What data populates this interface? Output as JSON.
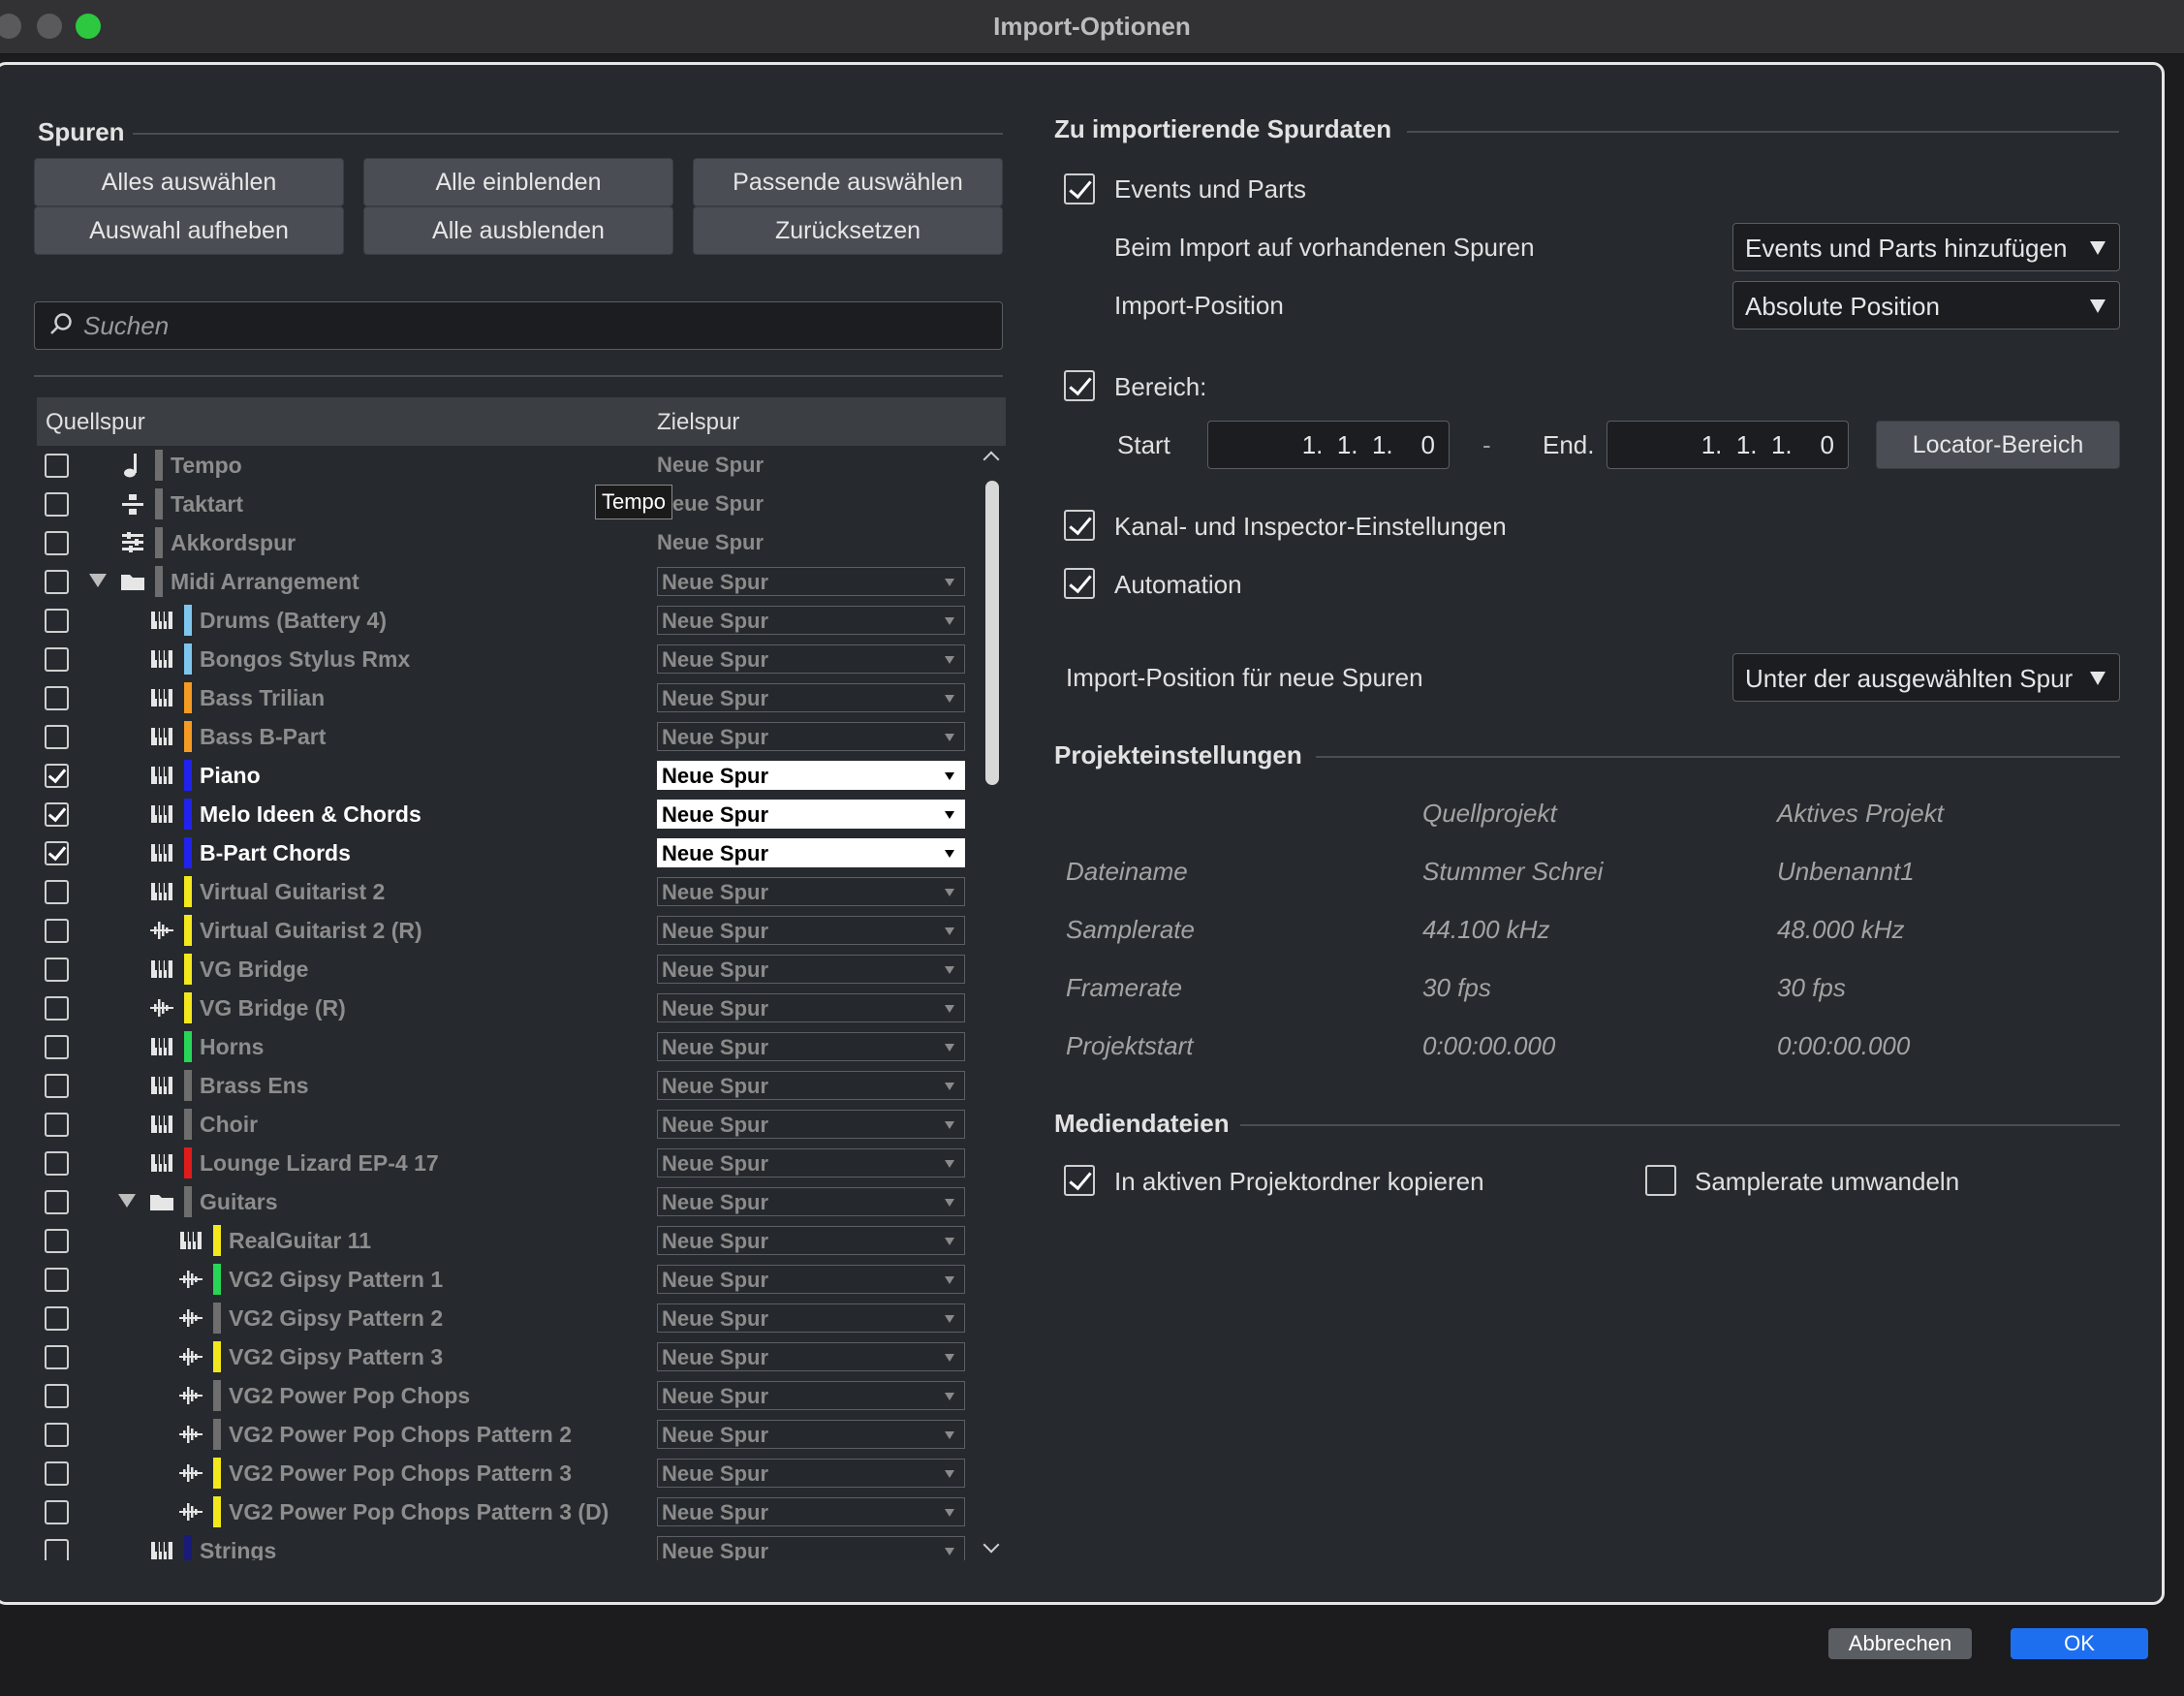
{
  "window": {
    "title": "Import-Optionen"
  },
  "tracks_section": {
    "title": "Spuren",
    "buttons": {
      "select_all": "Alles auswählen",
      "deselect": "Auswahl aufheben",
      "show_all": "Alle einblenden",
      "hide_all": "Alle ausblenden",
      "select_matching": "Passende auswählen",
      "reset": "Zurücksetzen"
    },
    "search_placeholder": "Suchen",
    "columns": {
      "source": "Quellspur",
      "target": "Zielspur"
    },
    "tooltip": "Tempo",
    "rows": [
      {
        "name": "Tempo",
        "checked": false,
        "indent": 0,
        "icon": "tempo-note-icon",
        "color": "#6e6e6e",
        "dest": "Neue Spur",
        "dropdown": false
      },
      {
        "name": "Taktart",
        "checked": false,
        "indent": 0,
        "icon": "signature-icon",
        "color": "#6e6e6e",
        "dest": "Neue Spur",
        "dropdown": false
      },
      {
        "name": "Akkordspur",
        "checked": false,
        "indent": 0,
        "icon": "chord-track-icon",
        "color": "#6e6e6e",
        "dest": "Neue Spur",
        "dropdown": false
      },
      {
        "name": "Midi Arrangement",
        "checked": false,
        "indent": 0,
        "icon": "folder-icon",
        "color": "#6e6e6e",
        "dest": "Neue Spur",
        "dropdown": true,
        "folder": true
      },
      {
        "name": "Drums (Battery 4)",
        "checked": false,
        "indent": 1,
        "icon": "instrument-icon",
        "color": "#7fc6ee",
        "dest": "Neue Spur",
        "dropdown": true
      },
      {
        "name": "Bongos Stylus Rmx",
        "checked": false,
        "indent": 1,
        "icon": "instrument-icon",
        "color": "#7fc6ee",
        "dest": "Neue Spur",
        "dropdown": true
      },
      {
        "name": "Bass Trilian",
        "checked": false,
        "indent": 1,
        "icon": "instrument-icon",
        "color": "#f59a23",
        "dest": "Neue Spur",
        "dropdown": true
      },
      {
        "name": "Bass B-Part",
        "checked": false,
        "indent": 1,
        "icon": "instrument-icon",
        "color": "#f59a23",
        "dest": "Neue Spur",
        "dropdown": true
      },
      {
        "name": "Piano",
        "checked": true,
        "indent": 1,
        "icon": "instrument-icon",
        "color": "#2222ee",
        "dest": "Neue Spur",
        "dropdown": true
      },
      {
        "name": "Melo Ideen & Chords",
        "checked": true,
        "indent": 1,
        "icon": "instrument-icon",
        "color": "#2222ee",
        "dest": "Neue Spur",
        "dropdown": true
      },
      {
        "name": "B-Part Chords",
        "checked": true,
        "indent": 1,
        "icon": "instrument-icon",
        "color": "#2222ee",
        "dest": "Neue Spur",
        "dropdown": true
      },
      {
        "name": "Virtual Guitarist 2",
        "checked": false,
        "indent": 1,
        "icon": "instrument-icon",
        "color": "#f2e81c",
        "dest": "Neue Spur",
        "dropdown": true
      },
      {
        "name": "Virtual Guitarist 2 (R)",
        "checked": false,
        "indent": 1,
        "icon": "audio-wave-icon",
        "color": "#f2e81c",
        "dest": "Neue Spur",
        "dropdown": true
      },
      {
        "name": "VG Bridge",
        "checked": false,
        "indent": 1,
        "icon": "instrument-icon",
        "color": "#f2e81c",
        "dest": "Neue Spur",
        "dropdown": true
      },
      {
        "name": "VG Bridge (R)",
        "checked": false,
        "indent": 1,
        "icon": "audio-wave-icon",
        "color": "#f2e81c",
        "dest": "Neue Spur",
        "dropdown": true
      },
      {
        "name": "Horns",
        "checked": false,
        "indent": 1,
        "icon": "instrument-icon",
        "color": "#27d657",
        "dest": "Neue Spur",
        "dropdown": true
      },
      {
        "name": "Brass Ens",
        "checked": false,
        "indent": 1,
        "icon": "instrument-icon",
        "color": "#6e6e6e",
        "dest": "Neue Spur",
        "dropdown": true
      },
      {
        "name": "Choir",
        "checked": false,
        "indent": 1,
        "icon": "instrument-icon",
        "color": "#6e6e6e",
        "dest": "Neue Spur",
        "dropdown": true
      },
      {
        "name": "Lounge Lizard EP-4 17",
        "checked": false,
        "indent": 1,
        "icon": "instrument-icon",
        "color": "#e01b1b",
        "dest": "Neue Spur",
        "dropdown": true
      },
      {
        "name": "Guitars",
        "checked": false,
        "indent": 1,
        "icon": "folder-icon",
        "color": "#6e6e6e",
        "dest": "Neue Spur",
        "dropdown": true,
        "folder": true
      },
      {
        "name": "RealGuitar 11",
        "checked": false,
        "indent": 2,
        "icon": "instrument-icon",
        "color": "#f2e81c",
        "dest": "Neue Spur",
        "dropdown": true
      },
      {
        "name": "VG2 Gipsy Pattern 1",
        "checked": false,
        "indent": 2,
        "icon": "audio-wave-icon",
        "color": "#27d657",
        "dest": "Neue Spur",
        "dropdown": true
      },
      {
        "name": "VG2 Gipsy Pattern 2",
        "checked": false,
        "indent": 2,
        "icon": "audio-wave-icon",
        "color": "#6e6e6e",
        "dest": "Neue Spur",
        "dropdown": true
      },
      {
        "name": "VG2 Gipsy Pattern 3",
        "checked": false,
        "indent": 2,
        "icon": "audio-wave-icon",
        "color": "#f2e81c",
        "dest": "Neue Spur",
        "dropdown": true
      },
      {
        "name": "VG2 Power Pop Chops",
        "checked": false,
        "indent": 2,
        "icon": "audio-wave-icon",
        "color": "#6e6e6e",
        "dest": "Neue Spur",
        "dropdown": true
      },
      {
        "name": "VG2 Power Pop Chops Pattern 2",
        "checked": false,
        "indent": 2,
        "icon": "audio-wave-icon",
        "color": "#6e6e6e",
        "dest": "Neue Spur",
        "dropdown": true
      },
      {
        "name": "VG2 Power Pop Chops Pattern 3",
        "checked": false,
        "indent": 2,
        "icon": "audio-wave-icon",
        "color": "#f2e81c",
        "dest": "Neue Spur",
        "dropdown": true
      },
      {
        "name": "VG2 Power Pop Chops Pattern 3 (D)",
        "checked": false,
        "indent": 2,
        "icon": "audio-wave-icon",
        "color": "#f2e81c",
        "dest": "Neue Spur",
        "dropdown": true
      },
      {
        "name": "Strings",
        "checked": false,
        "indent": 1,
        "icon": "instrument-icon",
        "color": "#1a1a7a",
        "dest": "Neue Spur",
        "dropdown": true
      }
    ]
  },
  "track_data_section": {
    "title": "Zu importierende Spurdaten",
    "events_parts": {
      "label": "Events und Parts",
      "checked": true
    },
    "existing_tracks": {
      "label": "Beim Import auf vorhandenen Spuren",
      "value": "Events und Parts hinzufügen"
    },
    "import_position": {
      "label": "Import-Position",
      "value": "Absolute Position"
    },
    "range": {
      "label": "Bereich:",
      "checked": true
    },
    "start": {
      "label": "Start",
      "value": "1.  1.  1.    0"
    },
    "dash": "-",
    "end": {
      "label": "End.",
      "value": "1.  1.  1.    0"
    },
    "locator_button": "Locator-Bereich",
    "channel_inspector": {
      "label": "Kanal- und Inspector-Einstellungen",
      "checked": true
    },
    "automation": {
      "label": "Automation",
      "checked": true
    },
    "new_track_position": {
      "label": "Import-Position für neue Spuren",
      "value": "Unter der ausgewählten Spur"
    }
  },
  "project_settings": {
    "title": "Projekteinstellungen",
    "headers": {
      "source": "Quellprojekt",
      "active": "Aktives Projekt"
    },
    "rows": [
      {
        "label": "Dateiname",
        "source": "Stummer Schrei",
        "active": "Unbenannt1"
      },
      {
        "label": "Samplerate",
        "source": "44.100 kHz",
        "active": "48.000 kHz"
      },
      {
        "label": "Framerate",
        "source": "30 fps",
        "active": "30 fps"
      },
      {
        "label": "Projektstart",
        "source": "0:00:00.000",
        "active": "0:00:00.000"
      }
    ]
  },
  "media_files": {
    "title": "Mediendateien",
    "copy_to_folder": {
      "label": "In aktiven Projektordner kopieren",
      "checked": true
    },
    "convert_samplerate": {
      "label": "Samplerate umwandeln",
      "checked": false
    }
  },
  "footer": {
    "cancel": "Abbrechen",
    "ok": "OK"
  }
}
